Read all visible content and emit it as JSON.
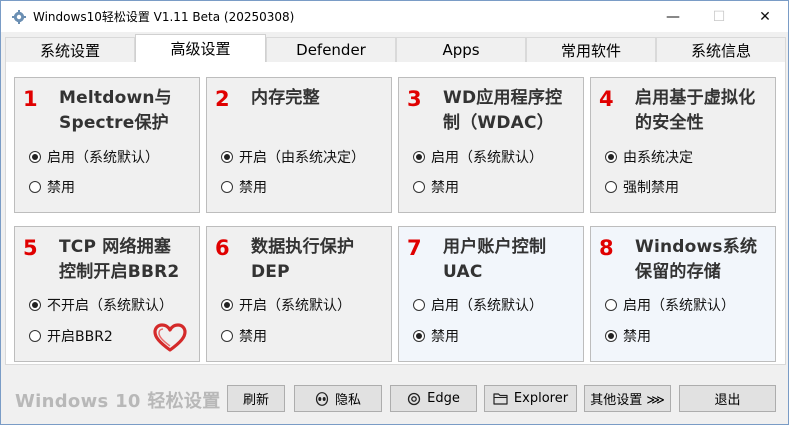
{
  "window": {
    "title": "Windows10轻松设置 V1.11 Beta (20250308)",
    "controls": {
      "minimize": "—",
      "maximize": "☐",
      "close": "✕"
    }
  },
  "tabs": [
    {
      "label": "系统设置",
      "active": false
    },
    {
      "label": "高级设置",
      "active": true
    },
    {
      "label": "Defender",
      "active": false
    },
    {
      "label": "Apps",
      "active": false
    },
    {
      "label": "常用软件",
      "active": false
    },
    {
      "label": "系统信息",
      "active": false
    }
  ],
  "cards": [
    {
      "num": "1",
      "title_line1": "Meltdown与",
      "title_line2": "Spectre保护",
      "options": [
        {
          "label": "启用（系统默认）",
          "selected": true
        },
        {
          "label": "禁用",
          "selected": false
        }
      ]
    },
    {
      "num": "2",
      "title_line1": "内存完整",
      "title_line2": "",
      "options": [
        {
          "label": "开启（由系统决定）",
          "selected": true
        },
        {
          "label": "禁用",
          "selected": false
        }
      ]
    },
    {
      "num": "3",
      "title_line1": "WD应用程序控",
      "title_line2": "制（WDAC）",
      "options": [
        {
          "label": "启用（系统默认）",
          "selected": true
        },
        {
          "label": "禁用",
          "selected": false
        }
      ]
    },
    {
      "num": "4",
      "title_line1": "启用基于虚拟化",
      "title_line2": "的安全性",
      "options": [
        {
          "label": "由系统决定",
          "selected": true
        },
        {
          "label": "强制禁用",
          "selected": false
        }
      ]
    },
    {
      "num": "5",
      "title_line1": "TCP 网络拥塞",
      "title_line2": "控制开启BBR2",
      "options": [
        {
          "label": "不开启（系统默认）",
          "selected": true
        },
        {
          "label": "开启BBR2",
          "selected": false
        }
      ]
    },
    {
      "num": "6",
      "title_line1": "数据执行保护",
      "title_line2": "DEP",
      "options": [
        {
          "label": "开启（系统默认）",
          "selected": true
        },
        {
          "label": "禁用",
          "selected": false
        }
      ]
    },
    {
      "num": "7",
      "title_line1": "用户账户控制",
      "title_line2": "UAC",
      "options": [
        {
          "label": "启用（系统默认）",
          "selected": false
        },
        {
          "label": "禁用",
          "selected": true
        }
      ]
    },
    {
      "num": "8",
      "title_line1": "Windows系统",
      "title_line2": "保留的存储",
      "options": [
        {
          "label": "启用（系统默认）",
          "selected": false
        },
        {
          "label": "禁用",
          "selected": true
        }
      ]
    }
  ],
  "footer": {
    "brand": "Windows 10 轻松设置",
    "buttons": {
      "refresh": "刷新",
      "privacy": "隐私",
      "edge": "Edge",
      "explorer": "Explorer",
      "other": "其他设置 ⋙",
      "exit": "退出"
    }
  },
  "colors": {
    "accent_number": "#e00000",
    "heart": "#d42a2a",
    "brand_text": "#b8b8b8"
  }
}
